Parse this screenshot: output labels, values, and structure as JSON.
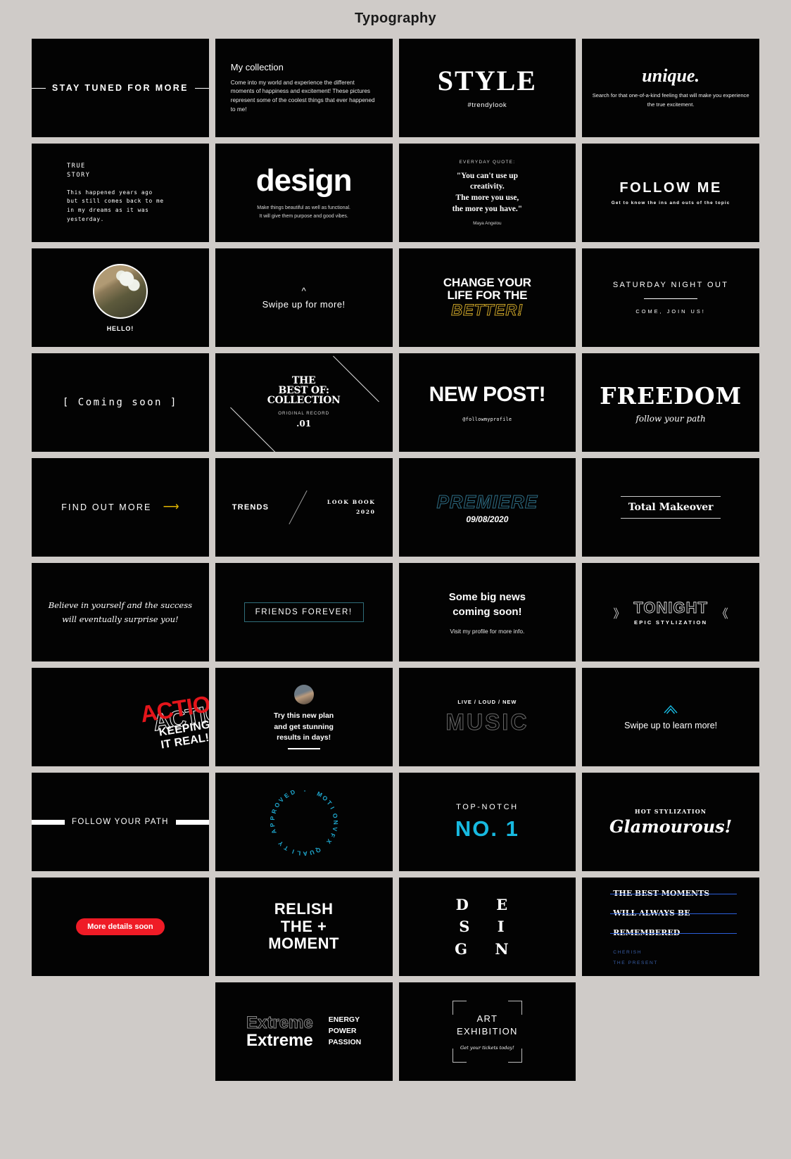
{
  "page": {
    "title": "Typography"
  },
  "tiles": {
    "stay_tuned": {
      "text": "STAY TUNED FOR MORE"
    },
    "my_collection": {
      "heading": "My collection",
      "body": "Come into my world and experience the different moments of happiness and excitement! These pictures represent some of the coolest things that ever happened to me!"
    },
    "style": {
      "title": "STYLE",
      "sub": "#trendylook"
    },
    "unique": {
      "title": "unique.",
      "sub": "Search for that one-of-a-kind feeling that will make you experience the true excitement."
    },
    "true_story": {
      "heading_1": "TRUE",
      "heading_2": "STORY",
      "line_1": "This happened years ago",
      "line_2": "but still comes back to me",
      "line_3": "in my dreams as it was yesterday."
    },
    "design": {
      "title": "design",
      "sub_1": "Make things beautiful as well as functional.",
      "sub_2": "It will give them purpose and good vibes."
    },
    "quote": {
      "label": "EVERYDAY QUOTE:",
      "line_1": "\"You can't use up",
      "line_2": "creativity.",
      "line_3": "The more you use,",
      "line_4": "the more you have.\"",
      "author": "Maya Angelou"
    },
    "follow_me": {
      "title": "FOLLOW ME",
      "sub": "Get to know the ins and outs of the topic"
    },
    "hello": {
      "label": "HELLO!"
    },
    "swipe_up": {
      "icon": "chevron-up",
      "text": "Swipe up for more!"
    },
    "change_life": {
      "line_1": "CHANGE YOUR",
      "line_2": "LIFE FOR THE",
      "line_3": "BETTER!",
      "accent": "#c9a227"
    },
    "saturday": {
      "title": "SATURDAY NIGHT OUT",
      "sub": "COME,  JOIN  US!"
    },
    "coming_soon": {
      "text": "[ Coming soon ]"
    },
    "best_of": {
      "line_1": "THE",
      "line_2": "BEST OF:",
      "line_3": "COLLECTION",
      "sub": "ORIGINAL RECORD",
      "number": ".01"
    },
    "new_post": {
      "title": "NEW POST!",
      "handle": "@followmyprofile"
    },
    "freedom": {
      "title": "FREEDOM",
      "sub": "follow your path"
    },
    "find_out_more": {
      "text": "FIND OUT MORE",
      "icon": "arrow-right",
      "accent": "#e0b400"
    },
    "trends": {
      "label": "TRENDS",
      "right_1": "LOOK BOOK",
      "right_2": "2020"
    },
    "premiere": {
      "title": "PREMIERE",
      "date": "09/08/2020",
      "accent": "#2e6e86"
    },
    "total_makeover": {
      "title": "Total Makeover"
    },
    "believe": {
      "line_1": "Believe in yourself and the success",
      "line_2": "will eventually surprise you!"
    },
    "friends": {
      "text": "FRIENDS FOREVER!",
      "border": "#2f6d7a"
    },
    "big_news": {
      "line_1": "Some big news",
      "line_2": "coming soon!",
      "sub": "Visit my profile for more info."
    },
    "tonight": {
      "bracket_left": "》",
      "title": "TONIGHT",
      "sub": "EPIC STYLIZATION",
      "bracket_right": "《"
    },
    "action": {
      "title": "ACTION",
      "outline": "ACTION",
      "sub": "KEEPING IT REAL!",
      "accent": "#e4151b"
    },
    "try_plan": {
      "line_1": "Try this new plan",
      "line_2": "and get stunning",
      "line_3": "results in days!"
    },
    "music": {
      "label": "LIVE / LOUD / NEW",
      "title": "MUSIC"
    },
    "swipe_learn": {
      "icon": "chevron-up-outline",
      "text": "Swipe up to learn more!",
      "accent": "#17b9e0"
    },
    "follow_path": {
      "text": "FOLLOW YOUR PATH"
    },
    "circle_badge": {
      "text": "- MOTIONVFX QUALITY APPROVED ",
      "accent": "#1fa8cf"
    },
    "no_one": {
      "label": "TOP-NOTCH",
      "value": "NO. 1",
      "accent": "#17b9e0"
    },
    "glamourous": {
      "label": "HOT STYLIZATION",
      "title": "Glamourous!"
    },
    "more_details": {
      "text": "More details soon",
      "accent": "#ef1b26"
    },
    "relish": {
      "line_1": "RELISH",
      "line_2": "THE +",
      "line_3": "MOMENT"
    },
    "design_letters": {
      "line_1": "D E",
      "line_2": "S  I",
      "line_3": "G N"
    },
    "best_moments": {
      "line_1": "THE BEST MOMENTS",
      "line_2": "WILL ALWAYS BE",
      "line_3": "REMEMBERED",
      "sub_1": "CHERISH",
      "sub_2": "THE PRESENT",
      "accent": "#2b5fd9"
    },
    "extreme": {
      "outline": "Extreme",
      "solid": "Extreme",
      "right_1": "ENERGY",
      "right_2": "POWER",
      "right_3": "PASSION"
    },
    "art_exhibition": {
      "line_1": "ART",
      "line_2": "EXHIBITION",
      "sub": "Get your tickets today!"
    }
  }
}
